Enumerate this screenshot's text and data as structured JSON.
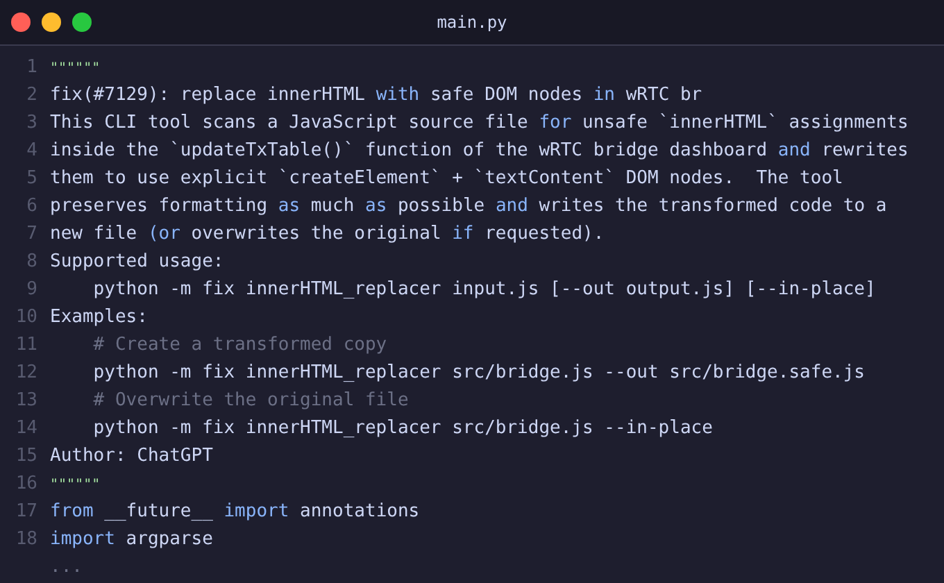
{
  "window": {
    "title": "main.py"
  },
  "lines": [
    {
      "number": "1",
      "tokens": [
        {
          "text": "\"\"\"\"\"\"",
          "kind": "string"
        }
      ]
    },
    {
      "number": "2",
      "tokens": [
        {
          "text": "fix(#7129): replace innerHTML ",
          "kind": "plain"
        },
        {
          "text": "with",
          "kind": "keyword"
        },
        {
          "text": " safe DOM nodes ",
          "kind": "plain"
        },
        {
          "text": "in",
          "kind": "keyword"
        },
        {
          "text": " wRTC br",
          "kind": "plain"
        }
      ]
    },
    {
      "number": "3",
      "tokens": [
        {
          "text": "This CLI tool scans a JavaScript source file ",
          "kind": "plain"
        },
        {
          "text": "for",
          "kind": "keyword"
        },
        {
          "text": " unsafe `innerHTML` assignments",
          "kind": "plain"
        }
      ]
    },
    {
      "number": "4",
      "tokens": [
        {
          "text": "inside the `updateTxTable()` function of the wRTC bridge dashboard ",
          "kind": "plain"
        },
        {
          "text": "and",
          "kind": "keyword"
        },
        {
          "text": " rewrites",
          "kind": "plain"
        }
      ]
    },
    {
      "number": "5",
      "tokens": [
        {
          "text": "them to use explicit `createElement` + `textContent` DOM nodes.  The tool",
          "kind": "plain"
        }
      ]
    },
    {
      "number": "6",
      "tokens": [
        {
          "text": "preserves formatting ",
          "kind": "plain"
        },
        {
          "text": "as",
          "kind": "keyword"
        },
        {
          "text": " much ",
          "kind": "plain"
        },
        {
          "text": "as",
          "kind": "keyword"
        },
        {
          "text": " possible ",
          "kind": "plain"
        },
        {
          "text": "and",
          "kind": "keyword"
        },
        {
          "text": " writes the transformed code to a",
          "kind": "plain"
        }
      ]
    },
    {
      "number": "7",
      "tokens": [
        {
          "text": "new file ",
          "kind": "plain"
        },
        {
          "text": "(or",
          "kind": "keyword"
        },
        {
          "text": " overwrites the original ",
          "kind": "plain"
        },
        {
          "text": "if",
          "kind": "keyword"
        },
        {
          "text": " requested).",
          "kind": "plain"
        }
      ]
    },
    {
      "number": "8",
      "tokens": [
        {
          "text": "Supported usage:",
          "kind": "plain"
        }
      ]
    },
    {
      "number": "9",
      "tokens": [
        {
          "text": "    python -m fix innerHTML_replacer input.js [--out output.js] [--in-place]",
          "kind": "plain"
        }
      ]
    },
    {
      "number": "10",
      "tokens": [
        {
          "text": "Examples:",
          "kind": "plain"
        }
      ]
    },
    {
      "number": "11",
      "tokens": [
        {
          "text": "    # Create a transformed copy",
          "kind": "comment"
        }
      ]
    },
    {
      "number": "12",
      "tokens": [
        {
          "text": "    python -m fix innerHTML_replacer src/bridge.js --out src/bridge.safe.js",
          "kind": "plain"
        }
      ]
    },
    {
      "number": "13",
      "tokens": [
        {
          "text": "    # Overwrite the original file",
          "kind": "comment"
        }
      ]
    },
    {
      "number": "14",
      "tokens": [
        {
          "text": "    python -m fix innerHTML_replacer src/bridge.js --in-place",
          "kind": "plain"
        }
      ]
    },
    {
      "number": "15",
      "tokens": [
        {
          "text": "Author: ChatGPT",
          "kind": "plain"
        }
      ]
    },
    {
      "number": "16",
      "tokens": [
        {
          "text": "\"\"\"\"\"\"",
          "kind": "string"
        }
      ]
    },
    {
      "number": "17",
      "tokens": [
        {
          "text": "from",
          "kind": "keyword"
        },
        {
          "text": " __future__ ",
          "kind": "plain"
        },
        {
          "text": "import",
          "kind": "keyword"
        },
        {
          "text": " annotations",
          "kind": "plain"
        }
      ]
    },
    {
      "number": "18",
      "tokens": [
        {
          "text": "import",
          "kind": "keyword"
        },
        {
          "text": " argparse",
          "kind": "plain"
        }
      ]
    },
    {
      "tokens": [
        {
          "text": "...",
          "kind": "comment"
        }
      ]
    }
  ]
}
